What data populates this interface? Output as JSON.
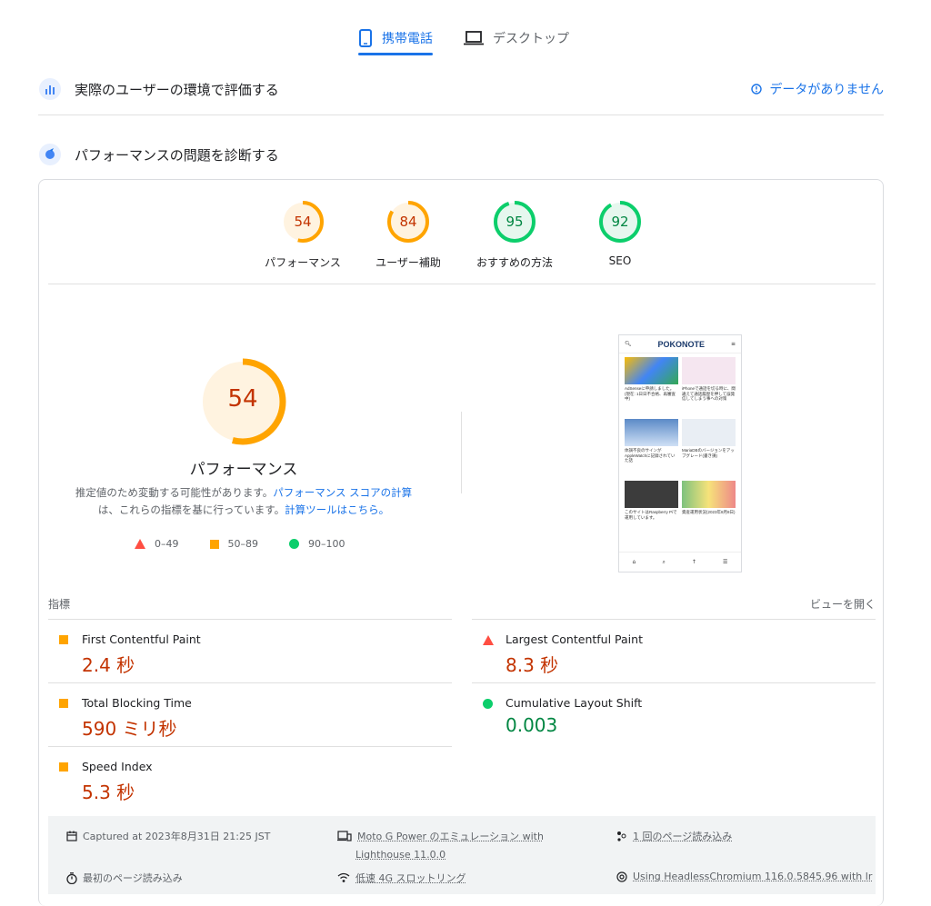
{
  "tabs": {
    "mobile": "携帯電話",
    "desktop": "デスクトップ"
  },
  "field": {
    "title": "実際のユーザーの環境で評価する",
    "no_data": "データがありません"
  },
  "lab": {
    "title": "パフォーマンスの問題を診断する"
  },
  "scores": [
    {
      "value": "54",
      "label": "パフォーマンス",
      "color": "#ffa400",
      "fraction": 0.54,
      "text_color": "#c33300",
      "bg": "#fff3e0"
    },
    {
      "value": "84",
      "label": "ユーザー補助",
      "color": "#ffa400",
      "fraction": 0.84,
      "text_color": "#c33300",
      "bg": "#fff3e0"
    },
    {
      "value": "95",
      "label": "おすすめの方法",
      "color": "#0cce6b",
      "fraction": 0.95,
      "text_color": "#018642",
      "bg": "#e6f7ee"
    },
    {
      "value": "92",
      "label": "SEO",
      "color": "#0cce6b",
      "fraction": 0.92,
      "text_color": "#018642",
      "bg": "#e6f7ee"
    }
  ],
  "perf": {
    "score": "54",
    "fraction": 0.54,
    "label": "パフォーマンス",
    "desc_1": "推定値のため変動する可能性があります。",
    "desc_link_1": "パフォーマンス スコアの計算",
    "desc_2": "は、これらの指標を基に行っています。",
    "desc_link_2": "計算ツールはこちら。"
  },
  "legend": {
    "fail": "0–49",
    "average": "50–89",
    "pass": "90–100"
  },
  "screenshot": {
    "logo": "POKONOTE",
    "menu": "≡",
    "cells": [
      "AdSenseに申請しました。(現在: 1日日不合格、再審査中)",
      "iPhoneで通話を切る時に、間違えて通話履歴を押して誤発信してしまう事への対策",
      "体調不良のサインがAppleWatchに記録されていた話",
      "MariaDBのバージョンをアップグレード(書き損)",
      "このサイトはRaspberry Piで運用しています。",
      "資産運用状況(2023年8月8日)"
    ]
  },
  "metrics_header": {
    "label": "指標",
    "open": "ビューを開く"
  },
  "metrics": {
    "fcp": {
      "name": "First Contentful Paint",
      "value": "2.4 秒"
    },
    "lcp": {
      "name": "Largest Contentful Paint",
      "value": "8.3 秒"
    },
    "tbt": {
      "name": "Total Blocking Time",
      "value": "590 ミリ秒"
    },
    "cls": {
      "name": "Cumulative Layout Shift",
      "value": "0.003"
    },
    "si": {
      "name": "Speed Index",
      "value": "5.3 秒"
    }
  },
  "info": {
    "captured": "Captured at 2023年8月31日 21:25 JST",
    "device_1": "Moto G Power のエミュレーション with",
    "device_2": "Lighthouse 11.0.0",
    "loads": "1 回のページ読み込み",
    "initial": "最初のページ読み込み",
    "throttle": "低速 4G スロットリング",
    "browser": "Using HeadlessChromium 116.0.5845.96 with lr"
  }
}
